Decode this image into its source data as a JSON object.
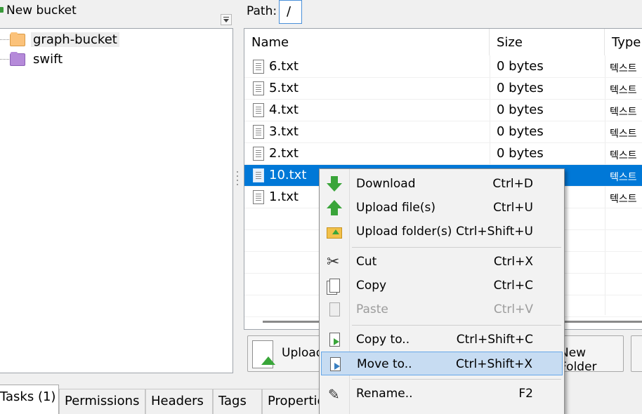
{
  "left_toolbar": {
    "new_bucket_label": "New bucket"
  },
  "tree": {
    "nodes": [
      {
        "label": "graph-bucket",
        "color": "#fbc27a",
        "selected": true
      },
      {
        "label": "swift",
        "color": "#b58ad9",
        "selected": false
      }
    ]
  },
  "path_bar": {
    "label": "Path:",
    "value": "/"
  },
  "file_list": {
    "columns": {
      "name": "Name",
      "size": "Size",
      "type": "Type"
    },
    "rows": [
      {
        "name": "6.txt",
        "size": "0 bytes",
        "type": "텍스트"
      },
      {
        "name": "5.txt",
        "size": "0 bytes",
        "type": "텍스트"
      },
      {
        "name": "4.txt",
        "size": "0 bytes",
        "type": "텍스트"
      },
      {
        "name": "3.txt",
        "size": "0 bytes",
        "type": "텍스트"
      },
      {
        "name": "2.txt",
        "size": "0 bytes",
        "type": "텍스트"
      },
      {
        "name": "10.txt",
        "size": "",
        "type": "텍스트",
        "selected": true
      },
      {
        "name": "1.txt",
        "size": "",
        "type": "텍스트"
      }
    ]
  },
  "actions": {
    "upload_label": "Upload",
    "new_folder_label": "New Folder"
  },
  "tabs": [
    "Tasks (1)",
    "Permissions",
    "Headers",
    "Tags",
    "Properties"
  ],
  "context_menu": {
    "items": [
      {
        "label": "Download",
        "shortcut": "Ctrl+D",
        "icon": "download-icon"
      },
      {
        "label": "Upload file(s)",
        "shortcut": "Ctrl+U",
        "icon": "upload-icon"
      },
      {
        "label": "Upload folder(s)",
        "shortcut": "Ctrl+Shift+U",
        "icon": "upload-folder-icon"
      },
      {
        "label": "Cut",
        "shortcut": "Ctrl+X",
        "icon": "scissors-icon"
      },
      {
        "label": "Copy",
        "shortcut": "Ctrl+C",
        "icon": "copy-icon"
      },
      {
        "label": "Paste",
        "shortcut": "Ctrl+V",
        "icon": "paste-icon",
        "disabled": true
      },
      {
        "label": "Copy to..",
        "shortcut": "Ctrl+Shift+C",
        "icon": "copy-to-icon"
      },
      {
        "label": "Move to..",
        "shortcut": "Ctrl+Shift+X",
        "icon": "move-to-icon",
        "highlighted": true
      },
      {
        "label": "Rename..",
        "shortcut": "F2",
        "icon": "pencil-icon"
      }
    ]
  },
  "colors": {
    "selection": "#0078d7",
    "menu_highlight": "#c7dcf2",
    "arrow_green": "#3aa53a"
  }
}
